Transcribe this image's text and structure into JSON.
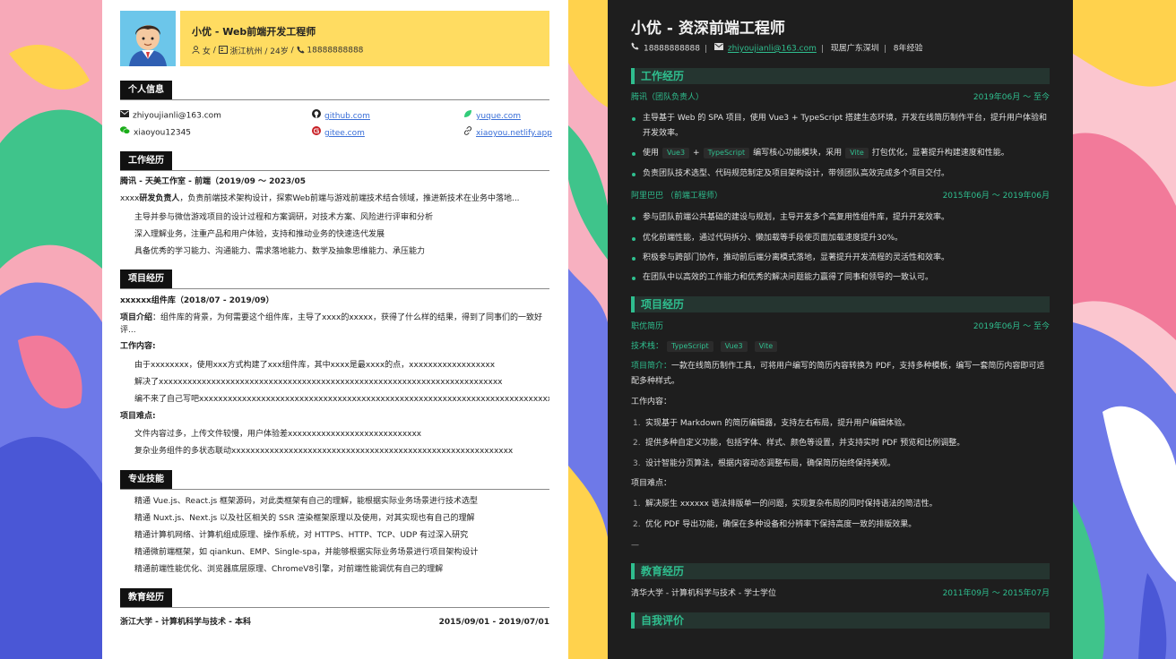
{
  "colors": {
    "accent_green": "#2fbf8f",
    "banner_yellow": "#ffdc61",
    "dark_bg": "#1e1e1e",
    "section_black": "#111111"
  },
  "light_resume": {
    "name_title": "小优 - Web前端开发工程师",
    "info": {
      "gender": "女",
      "location_age": "浙江杭州 / 24岁",
      "phone": "18888888888"
    },
    "sections": {
      "personal": "个人信息",
      "work": "工作经历",
      "project": "项目经历",
      "skills": "专业技能",
      "education": "教育经历"
    },
    "contacts": {
      "email": "zhiyoujianli@163.com",
      "wechat": "xiaoyou12345",
      "github": "github.com",
      "gitee": "gitee.com",
      "yuque": "yuque.com",
      "site": "xiaoyou.netlify.app"
    },
    "work": {
      "company": "腾讯 - 天美工作室 - 前端（2019/09 ～ 2023/05",
      "summary_prefix": "xxxx",
      "summary_bold": "研发负责人",
      "summary_rest": "，负责前端技术架构设计，探索Web前端与游戏前端技术结合领域，推进新技术在业务中落地...",
      "bullets": [
        "主导并参与微信游戏项目的设计过程和方案调研，对技术方案、风险进行评审和分析",
        "深入理解业务，注重产品和用户体验，支持和推动业务的快速迭代发展",
        "具备优秀的学习能力、沟通能力、需求落地能力、数学及抽象思维能力、承压能力"
      ]
    },
    "project": {
      "name": "xxxxxx组件库（2018/07 - 2019/09）",
      "intro_label": "项目介绍",
      "intro_text": "：组件库的背景，为何需要这个组件库，主导了xxxx的xxxxx，获得了什么样的结果，得到了同事们的一致好",
      "intro_text2": "评...",
      "content_label": "工作内容",
      "content_bullets": [
        "由于xxxxxxxx，使用xxx方式构建了xxx组件库，其中xxxx是最xxxx的点，xxxxxxxxxxxxxxxxxx",
        "解决了xxxxxxxxxxxxxxxxxxxxxxxxxxxxxxxxxxxxxxxxxxxxxxxxxxxxxxxxxxxxxxxxxxxxxxxx",
        "编不来了自己写吧xxxxxxxxxxxxxxxxxxxxxxxxxxxxxxxxxxxxxxxxxxxxxxxxxxxxxxxxxxxxxxxxxxxxxxxxxxx"
      ],
      "difficulty_label": "项目难点",
      "difficulty_bullets": [
        "文件内容过多，上传文件较慢，用户体验差xxxxxxxxxxxxxxxxxxxxxxxxxxxx",
        "复杂业务组件的多状态联动xxxxxxxxxxxxxxxxxxxxxxxxxxxxxxxxxxxxxxxxxxxxxxxxxxxxxxxxxxx"
      ]
    },
    "skills": [
      "精通 Vue.js、React.js 框架源码，对此类框架有自己的理解，能根据实际业务场景进行技术选型",
      "精通 Nuxt.js、Next.js 以及社区相关的 SSR 渲染框架原理以及使用，对其实现也有自己的理解",
      "精通计算机网络、计算机组成原理、操作系统，对 HTTPS、HTTP、TCP、UDP 有过深入研究",
      "精通微前端框架，如 qiankun、EMP、Single-spa，并能够根据实际业务场景进行项目架构设计",
      "精通前端性能优化、浏览器底层原理、ChromeV8引擎，对前端性能调优有自己的理解"
    ],
    "education": {
      "school": "浙江大学 - 计算机科学与技术 - 本科",
      "period": "2015/09/01 - 2019/07/01"
    }
  },
  "dark_resume": {
    "name_title": "小优 - 资深前端工程师",
    "info": {
      "phone": "18888888888",
      "email": "zhiyoujianli@163.com",
      "location": "现居广东深圳",
      "experience": "8年经验"
    },
    "sections": {
      "work": "工作经历",
      "project": "项目经历",
      "education": "教育经历",
      "self": "自我评价"
    },
    "job1": {
      "company": "腾讯（团队负责人）",
      "period": "2019年06月 ～ 至今",
      "b1": "主导基于 Web 的 SPA 项目，使用 Vue3 + TypeScript 搭建生态环境，开发在线简历制作平台，提升用户体验和开发效率。",
      "b2_pre": "使用",
      "b2_tag1": "Vue3",
      "b2_plus": "+",
      "b2_tag2": "TypeScript",
      "b2_mid": "编写核心功能模块，采用",
      "b2_tag3": "Vite",
      "b2_post": "打包优化，显著提升构建速度和性能。",
      "b3": "负责团队技术选型、代码规范制定及项目架构设计，带领团队高效完成多个项目交付。"
    },
    "job2": {
      "company": "阿里巴巴 （前端工程师）",
      "period": "2015年06月 ～ 2019年06月",
      "bullets": [
        "参与团队前端公共基础的建设与规划，主导开发多个高复用性组件库，提升开发效率。",
        "优化前端性能，通过代码拆分、懒加载等手段使页面加载速度提升30%。",
        "积极参与跨部门协作，推动前后端分离模式落地，显著提升开发流程的灵活性和效率。",
        "在团队中以高效的工作能力和优秀的解决问题能力赢得了同事和领导的一致认可。"
      ]
    },
    "project": {
      "name": "职优简历",
      "period": "2019年06月 ～ 至今",
      "tech_label": "技术栈：",
      "tech_tags": [
        "TypeScript",
        "Vue3",
        "Vite"
      ],
      "intro_label": "项目简介：",
      "intro_text": "一款在线简历制作工具，可将用户编写的简历内容转换为 PDF，支持多种模板，编写一套简历内容即可适配多种样式。",
      "content_label": "工作内容：",
      "content": [
        "实现基于 Markdown 的简历编辑器，支持左右布局，提升用户编辑体验。",
        "提供多种自定义功能，包括字体、样式、颜色等设置，并支持实时 PDF 预览和比例调整。",
        "设计智能分页算法，根据内容动态调整布局，确保简历始终保持美观。"
      ],
      "difficulty_label": "项目难点：",
      "difficulty": [
        "解决原生 xxxxxx 语法排版单一的问题，实现复杂布局的同时保持语法的简洁性。",
        "优化 PDF 导出功能，确保在多种设备和分辨率下保持高度一致的排版效果。"
      ],
      "divider": "—"
    },
    "education": {
      "school": "清华大学 - 计算机科学与技术 - 学士学位",
      "period": "2011年09月 ～ 2015年07月"
    }
  }
}
